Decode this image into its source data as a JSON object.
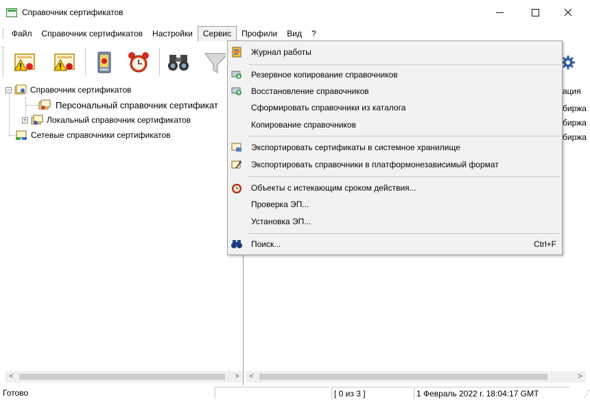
{
  "window": {
    "title": "Справочник сертификатов",
    "minimize_glyph": "—",
    "maximize_glyph": "☐",
    "close_glyph": "✕"
  },
  "menubar": {
    "items": [
      "Файл",
      "Справочник сертификатов",
      "Настройки",
      "Сервис",
      "Профили",
      "Вид",
      "?"
    ],
    "active": "Сервис"
  },
  "toolbar": {
    "buttons": [
      "cert-warning-icon",
      "cert-warning-alt-icon",
      "certificate-phone-icon",
      "alarm-clock-icon",
      "binoculars-icon",
      "filter-funnel-icon",
      "gear-icon"
    ]
  },
  "tree": {
    "root": "Справочник сертификатов",
    "personal": "Персональный справочник сертификат",
    "local": "Локальный справочник сертификатов",
    "network": "Сетевые справочники сертификатов"
  },
  "right_pane": {
    "column_fragment": "ация",
    "rows": [
      "биржа",
      "биржа",
      "биржа"
    ]
  },
  "scrollbars": {
    "left_arrow": "<",
    "right_arrow": ">"
  },
  "statusbar": {
    "ready": "Готово",
    "count": "[ 0 из 3 ]",
    "datetime": "1 Февраль 2022 г. 18:04:17 GMT"
  },
  "service_menu": {
    "items": [
      {
        "label": "Журнал работы",
        "icon": "journal-icon"
      },
      {
        "label": "Резервное копирование справочников",
        "icon": "backup-icon"
      },
      {
        "label": "Восстановление справочников",
        "icon": "restore-icon"
      },
      {
        "label": "Сформировать справочники из каталога",
        "icon": ""
      },
      {
        "label": "Копирование справочников",
        "icon": ""
      },
      {
        "label": "Экспортировать сертификаты в системное хранилище",
        "icon": "export-certs-icon"
      },
      {
        "label": "Экспортировать справочники в платформонезависимый формат",
        "icon": "export-format-icon"
      },
      {
        "label": "Объекты с истекающим сроком действия...",
        "icon": "alarm-clock-icon"
      },
      {
        "label": "Проверка ЭП...",
        "icon": ""
      },
      {
        "label": "Установка ЭП...",
        "icon": ""
      },
      {
        "label": "Поиск...",
        "icon": "binoculars-icon",
        "shortcut": "Ctrl+F"
      }
    ]
  },
  "colors": {
    "selection": "#cce8ff",
    "menu_bg": "#f2f2f2",
    "border": "#a0a0a0"
  }
}
